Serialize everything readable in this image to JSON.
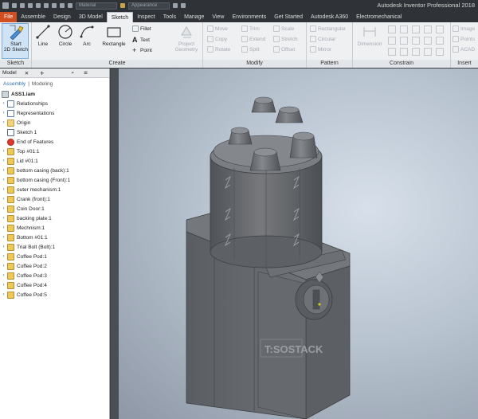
{
  "quick_access": {
    "material_placeholder": "Material",
    "appearance_placeholder": "Appearance"
  },
  "app_title": "Autodesk Inventor Professional 2018",
  "tabs": [
    "File",
    "Assemble",
    "Design",
    "3D Model",
    "Sketch",
    "Inspect",
    "Tools",
    "Manage",
    "View",
    "Environments",
    "Get Started",
    "Autodesk A360",
    "Electromechanical"
  ],
  "ribbon": {
    "sketch_panel": {
      "title": "Sketch",
      "start_label_1": "Start",
      "start_label_2": "2D Sketch"
    },
    "create_panel": {
      "title": "Create",
      "line": "Line",
      "circle": "Circle",
      "arc": "Arc",
      "rectangle": "Rectangle",
      "fillet": "Fillet",
      "text": "Text",
      "point": "Point",
      "project_1": "Project",
      "project_2": "Geometry"
    },
    "modify_panel": {
      "title": "Modify",
      "move": "Move",
      "trim": "Trim",
      "scale": "Scale",
      "copy": "Copy",
      "extend": "Extend",
      "stretch": "Stretch",
      "rotate": "Rotate",
      "split": "Split",
      "offset": "Offset"
    },
    "pattern_panel": {
      "title": "Pattern",
      "rectangular": "Rectangular",
      "circular": "Circular",
      "mirror": "Mirror"
    },
    "constrain_panel": {
      "title": "Constrain",
      "dimension": "Dimension"
    },
    "insert_panel": {
      "title": "Insert",
      "image": "Image",
      "points": "Points",
      "acad": "ACAD"
    }
  },
  "browser": {
    "title": "Model",
    "tab_assembly": "Assembly",
    "tab_modeling": "Modeling",
    "root": "ASS1.iam",
    "items": [
      {
        "label": "Relationships",
        "icon": "rel"
      },
      {
        "label": "Representations",
        "icon": "rel"
      },
      {
        "label": "Origin",
        "icon": "fold"
      },
      {
        "label": "Sketch 1",
        "icon": "sketch"
      },
      {
        "label": "End of Features",
        "icon": "eof"
      },
      {
        "label": "Top #01:1",
        "icon": "part"
      },
      {
        "label": "Lid #01:1",
        "icon": "part"
      },
      {
        "label": "bottom casing (back):1",
        "icon": "part"
      },
      {
        "label": "bottom casing (Front):1",
        "icon": "part"
      },
      {
        "label": "outer mechanism:1",
        "icon": "part"
      },
      {
        "label": "Crank (front):1",
        "icon": "part"
      },
      {
        "label": "Coin Door:1",
        "icon": "part"
      },
      {
        "label": "backing plate:1",
        "icon": "part"
      },
      {
        "label": "Mechnism:1",
        "icon": "part"
      },
      {
        "label": "Bottom #01:1",
        "icon": "part"
      },
      {
        "label": "Trial Bolt (Bolt):1",
        "icon": "part"
      },
      {
        "label": "Coffee Pod:1",
        "icon": "part"
      },
      {
        "label": "Coffee Pod:2",
        "icon": "part"
      },
      {
        "label": "Coffee Pod:3",
        "icon": "part"
      },
      {
        "label": "Coffee Pod:4",
        "icon": "part"
      },
      {
        "label": "Coffee Pod:5",
        "icon": "part"
      }
    ]
  },
  "model": {
    "engraving": "T:SOSTACK"
  },
  "colors": {
    "file_tab": "#d14e20",
    "active_tab": "#eef0f2",
    "ribbon": "#eef0f2",
    "model_gray": "#6a6d72"
  }
}
